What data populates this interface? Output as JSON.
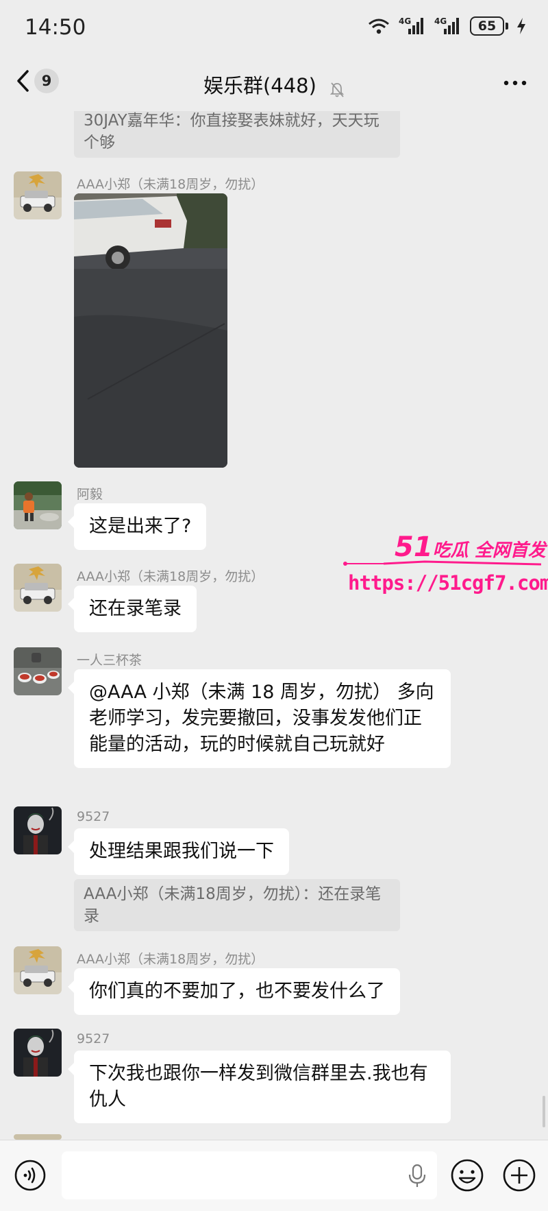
{
  "status_bar": {
    "time": "14:50",
    "network_1": "4G",
    "network_2": "4G",
    "battery": "65",
    "icons": [
      "wifi-icon",
      "signal-icon",
      "signal-icon",
      "battery-icon",
      "charging-icon"
    ]
  },
  "header": {
    "unread_count": "9",
    "title": "娱乐群(448)",
    "icons": [
      "back-icon",
      "mute-bell-icon",
      "more-icon"
    ]
  },
  "messages": [
    {
      "type": "quote",
      "text": "30JAY嘉年华：你直接娶表妹就好，天天玩个够"
    },
    {
      "type": "image",
      "sender": "AAA小郑（未满18周岁，勿扰）",
      "avatar": "car-avatar"
    },
    {
      "type": "text",
      "sender": "阿毅",
      "text": "这是出来了?",
      "avatar": "orange-person-avatar"
    },
    {
      "type": "text",
      "sender": "AAA小郑（未满18周岁，勿扰）",
      "text": "还在录笔录",
      "avatar": "car-avatar"
    },
    {
      "type": "text",
      "sender": "一人三杯茶",
      "text": "@AAA 小郑（未满 18 周岁，勿扰） 多向老师学习，发完要撤回，没事发发他们正能量的活动，玩的时候就自己玩就好",
      "avatar": "tea-avatar"
    },
    {
      "type": "text",
      "sender": "9527",
      "text": "处理结果跟我们说一下",
      "avatar": "joker-avatar",
      "quote": "AAA小郑（未满18周岁，勿扰）：还在录笔录"
    },
    {
      "type": "text",
      "sender": "AAA小郑（未满18周岁，勿扰）",
      "text": "你们真的不要加了，也不要发什么了",
      "avatar": "car-avatar"
    },
    {
      "type": "text",
      "sender": "9527",
      "text": "下次我也跟你一样发到微信群里去.我也有仇人",
      "avatar": "joker-avatar"
    }
  ],
  "watermark": {
    "brand_num": "51",
    "brand_text": "吃瓜 全网首发",
    "url": "https://51cgf7.com"
  },
  "input_bar": {
    "placeholder": "",
    "icons": [
      "voice-icon",
      "microphone-icon",
      "emoji-icon",
      "plus-icon"
    ]
  },
  "colors": {
    "background": "#ededed",
    "bubble": "#ffffff",
    "quote": "#e2e2e2",
    "watermark": "#ff1a8c"
  }
}
